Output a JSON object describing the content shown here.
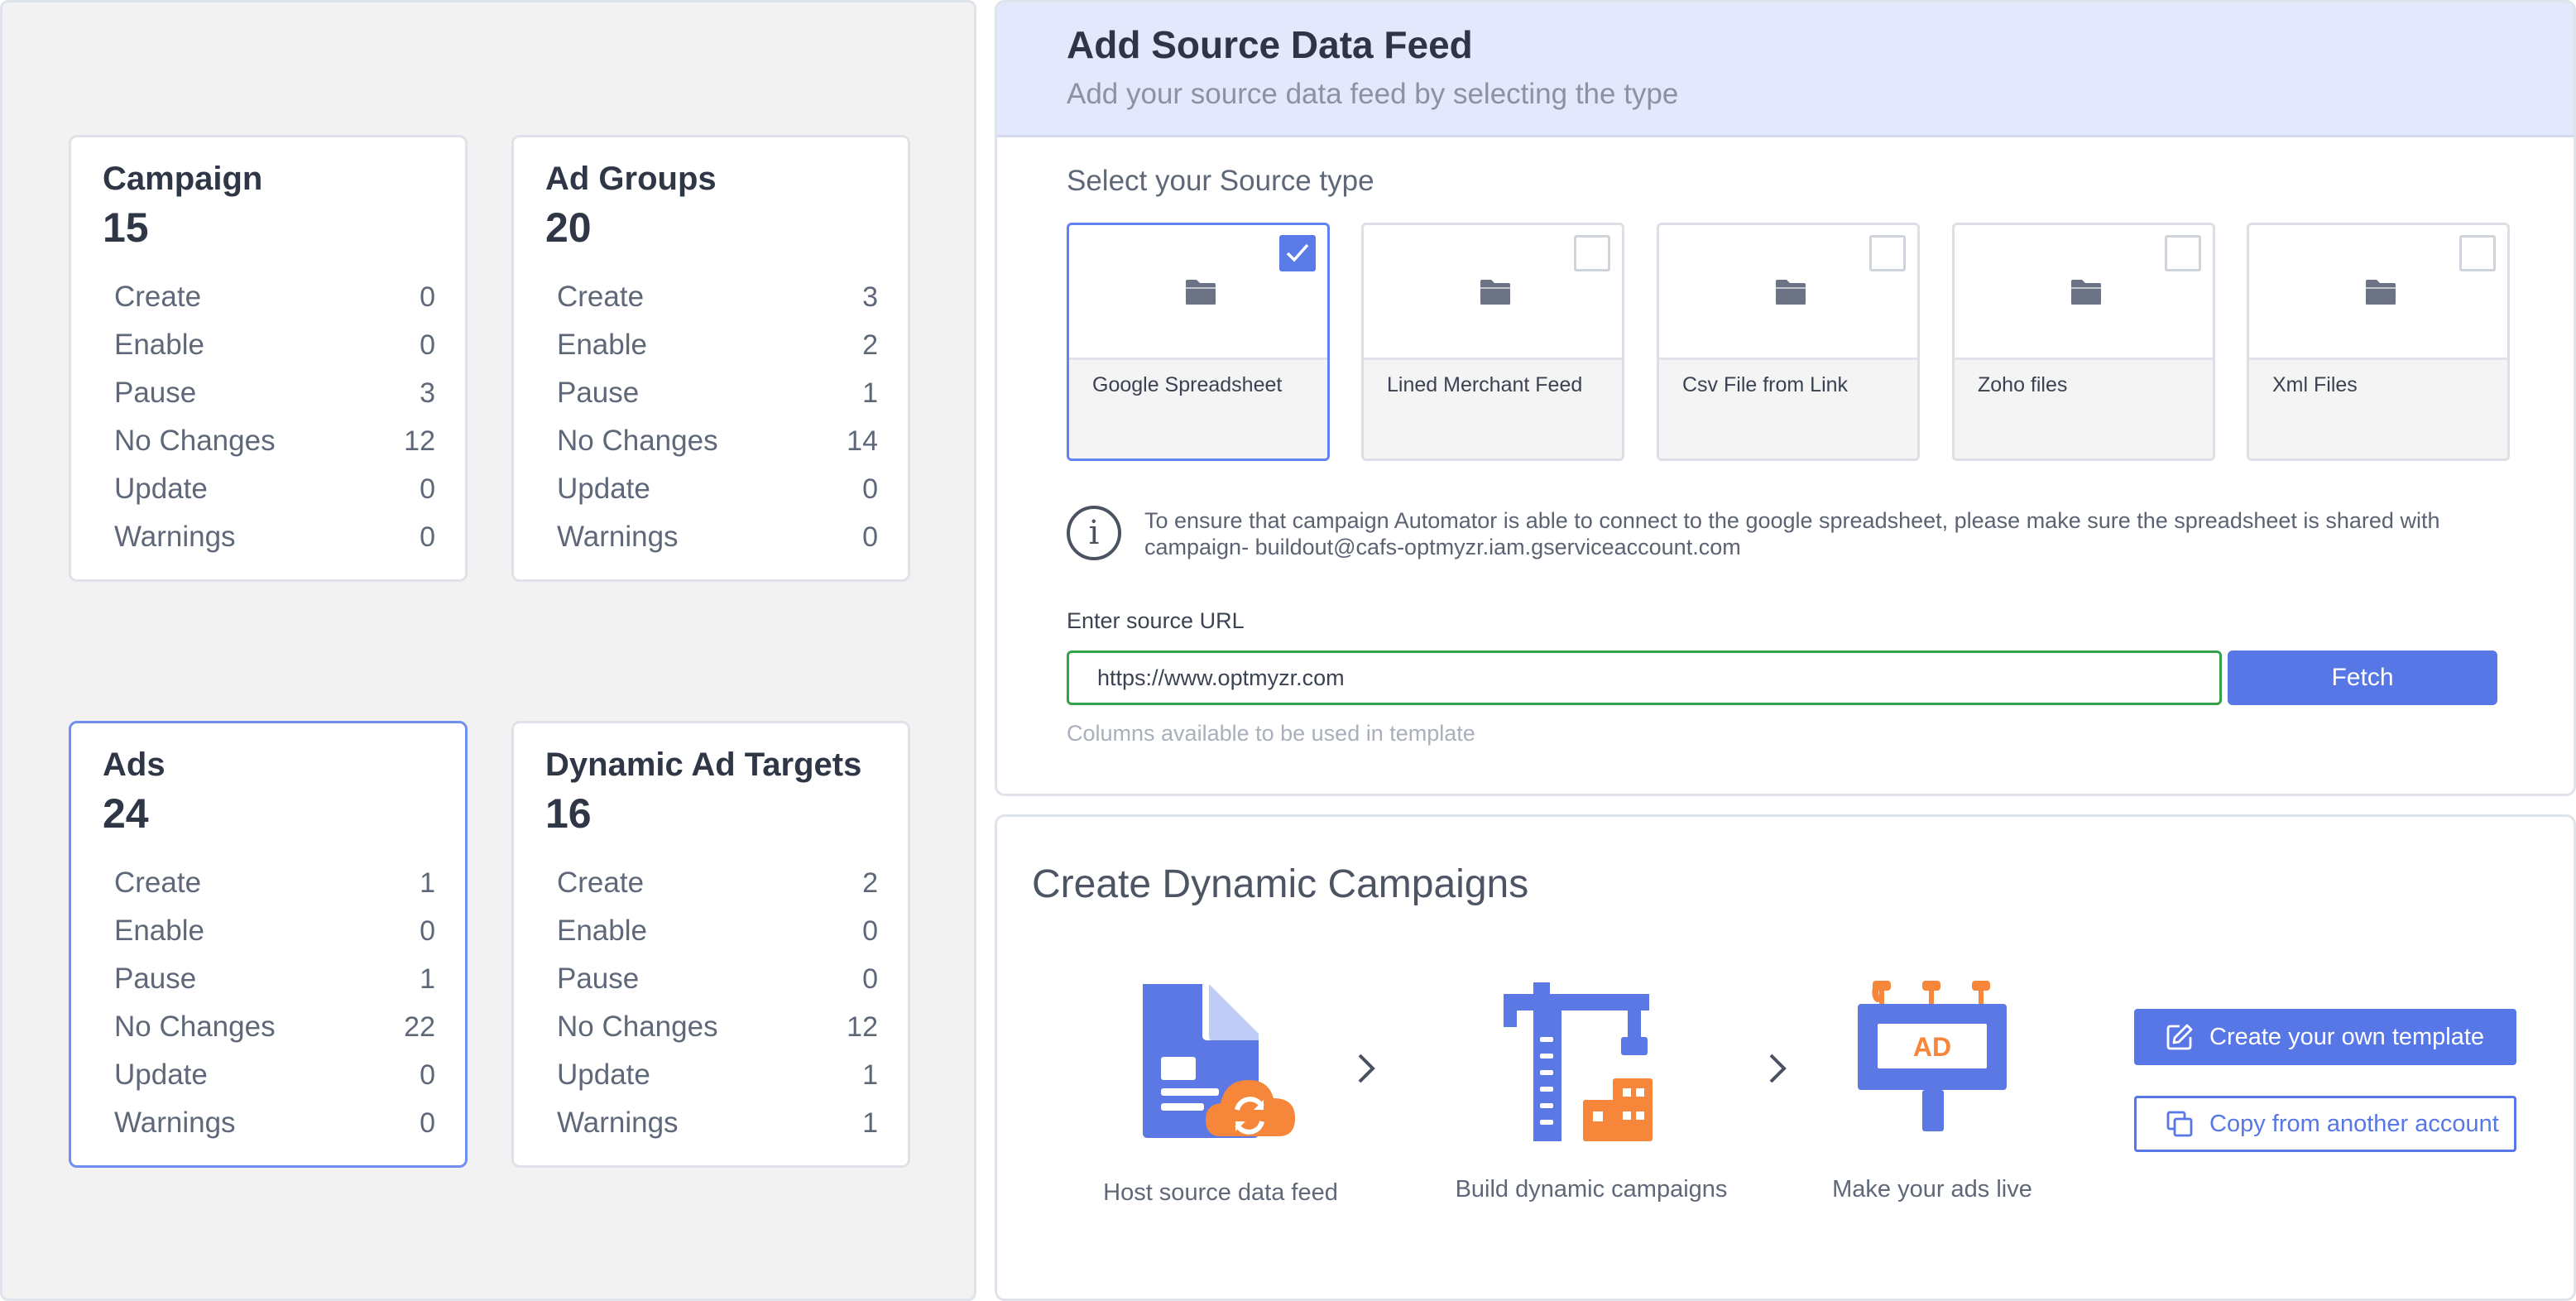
{
  "summary": {
    "cards": [
      {
        "title": "Campaign",
        "total": "15",
        "rows": [
          {
            "label": "Create",
            "value": "0"
          },
          {
            "label": "Enable",
            "value": "0"
          },
          {
            "label": "Pause",
            "value": "3"
          },
          {
            "label": "No Changes",
            "value": "12"
          },
          {
            "label": "Update",
            "value": "0"
          },
          {
            "label": "Warnings",
            "value": "0"
          }
        ]
      },
      {
        "title": "Ad Groups",
        "total": "20",
        "rows": [
          {
            "label": "Create",
            "value": "3"
          },
          {
            "label": "Enable",
            "value": "2"
          },
          {
            "label": "Pause",
            "value": "1"
          },
          {
            "label": "No Changes",
            "value": "14"
          },
          {
            "label": "Update",
            "value": "0"
          },
          {
            "label": "Warnings",
            "value": "0"
          }
        ]
      },
      {
        "title": "Ads",
        "total": "24",
        "rows": [
          {
            "label": "Create",
            "value": "1"
          },
          {
            "label": "Enable",
            "value": "0"
          },
          {
            "label": "Pause",
            "value": "1"
          },
          {
            "label": "No Changes",
            "value": "22"
          },
          {
            "label": "Update",
            "value": "0"
          },
          {
            "label": "Warnings",
            "value": "0"
          }
        ]
      },
      {
        "title": "Dynamic Ad Targets",
        "total": "16",
        "rows": [
          {
            "label": "Create",
            "value": "2"
          },
          {
            "label": "Enable",
            "value": "0"
          },
          {
            "label": "Pause",
            "value": "0"
          },
          {
            "label": "No Changes",
            "value": "12"
          },
          {
            "label": "Update",
            "value": "1"
          },
          {
            "label": "Warnings",
            "value": "1"
          }
        ]
      }
    ],
    "selected_card": "Ads"
  },
  "feed": {
    "title": "Add Source Data Feed",
    "subtitle": "Add your source data feed by selecting the type",
    "section_label": "Select your Source type",
    "sources": [
      {
        "label": "Google Spreadsheet",
        "checked": true
      },
      {
        "label": "Lined Merchant Feed",
        "checked": false
      },
      {
        "label": "Csv File from Link",
        "checked": false
      },
      {
        "label": "Zoho files",
        "checked": false
      },
      {
        "label": "Xml Files",
        "checked": false
      }
    ],
    "info_line1": "To ensure that campaign Automator is able to connect to the google spreadsheet, please make sure the spreadsheet is shared with",
    "info_line2": "campaign- buildout@cafs-optmyzr.iam.gserviceaccount.com",
    "url_label": "Enter source URL",
    "url_value": "https://www.optmyzr.com",
    "fetch_label": "Fetch",
    "columns_note": "Columns available to be used in template"
  },
  "dynamic": {
    "title": "Create Dynamic Campaigns",
    "steps": [
      {
        "label": "Host source data feed",
        "icon": "cloud-file-icon"
      },
      {
        "label": "Build dynamic campaigns",
        "icon": "crane-building-icon"
      },
      {
        "label": "Make your ads live",
        "icon": "ad-billboard-icon",
        "badge": "AD"
      }
    ],
    "create_template_label": "Create your own template",
    "copy_account_label": "Copy from another account"
  },
  "colors": {
    "accent": "#5877e6",
    "orange": "#f5863a",
    "header_bg": "#e3e8fd",
    "url_border": "#35a14b"
  }
}
